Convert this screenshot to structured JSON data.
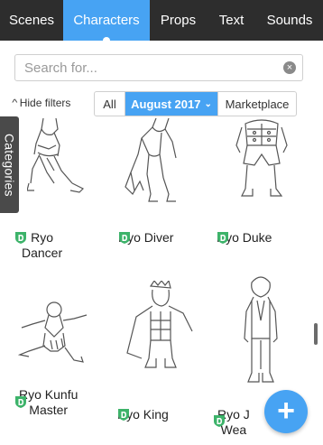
{
  "nav": {
    "tabs": [
      {
        "label": "Scenes"
      },
      {
        "label": "Characters",
        "active": true
      },
      {
        "label": "Props"
      },
      {
        "label": "Text"
      },
      {
        "label": "Sounds"
      }
    ]
  },
  "search": {
    "placeholder": "Search for...",
    "value": ""
  },
  "filters": {
    "hide_label": "Hide filters",
    "options": [
      "All",
      "August 2017",
      "Marketplace"
    ],
    "selected": "August 2017"
  },
  "categories_label": "Categories",
  "characters": [
    {
      "name": "Ryo Dancer",
      "line1": "Ryo",
      "line2": "Dancer",
      "pose": "dancer"
    },
    {
      "name": "Ryo Diver",
      "line1": "Ryo Diver",
      "line2": "",
      "pose": "diver"
    },
    {
      "name": "Ryo Duke",
      "line1": "Ryo Duke",
      "line2": "",
      "pose": "duke"
    },
    {
      "name": "Ryo Kunfu Master",
      "line1": "Ryo Kunfu",
      "line2": "Master",
      "pose": "kungfu"
    },
    {
      "name": "Ryo King",
      "line1": "Ryo King",
      "line2": "",
      "pose": "king"
    },
    {
      "name": "Ryo J... Wea...",
      "line1": "Ryo J",
      "line2": "Wea",
      "pose": "wear"
    }
  ],
  "badge_letter": "D",
  "colors": {
    "accent": "#47a3f3",
    "nav_bg": "#2d2d2d",
    "badge": "#3db36a",
    "categories_bg": "#4a4a4a"
  },
  "add_button": {
    "icon": "plus-icon"
  }
}
